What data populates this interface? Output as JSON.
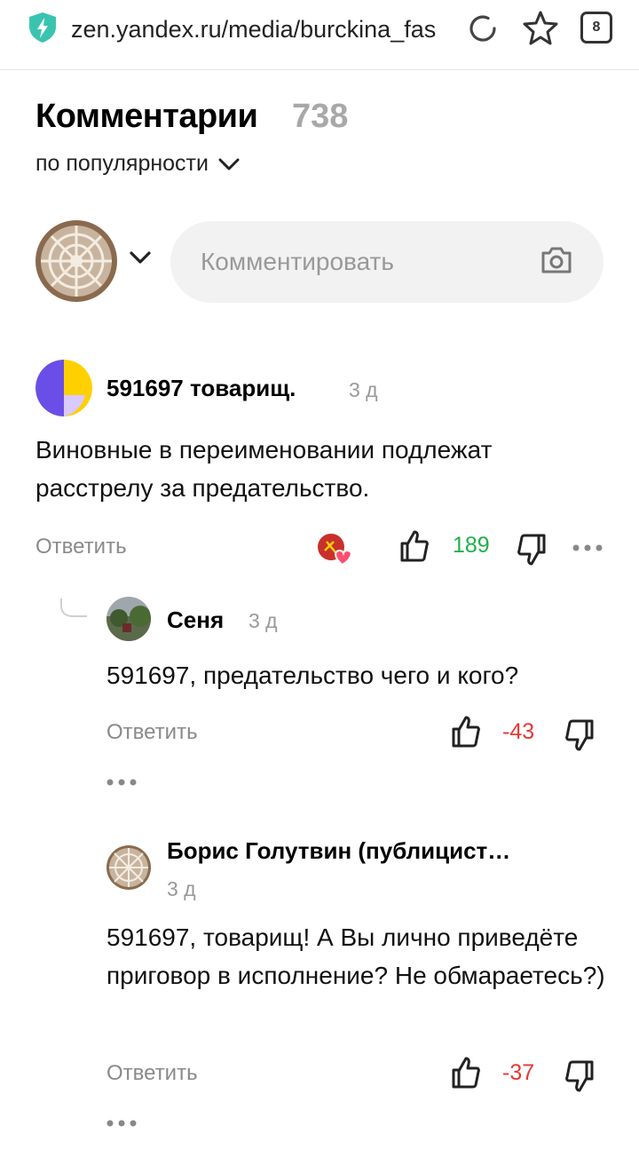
{
  "browser": {
    "url": "zen.yandex.ru/media/burckina_fas",
    "tab_count": "8",
    "shield_icon": "shield-bolt-icon",
    "accent": "#3ac4b0"
  },
  "header": {
    "title": "Комментарии",
    "count": "738",
    "sort_label": "по популярности"
  },
  "compose": {
    "placeholder": "Комментировать"
  },
  "comments": [
    {
      "author": "591697 товарищ.",
      "time": "3 д",
      "text": "Виновные в переименовании подлежат расстрелу за предательство.",
      "reply_label": "Ответить",
      "score": "189",
      "score_color": "#1fb14a",
      "replies": [
        {
          "author": "Сеня",
          "time": "3 д",
          "text": "591697, предательство чего и кого?",
          "reply_label": "Ответить",
          "score": "-43",
          "score_color": "#e53935"
        },
        {
          "author": "Борис Голутвин (публицист…",
          "time": "3 д",
          "text": "591697, товарищ! А Вы лично приведёте приговор в исполнение? Не обмараетесь?)",
          "reply_label": "Ответить",
          "score": "-37",
          "score_color": "#e53935"
        }
      ]
    }
  ]
}
